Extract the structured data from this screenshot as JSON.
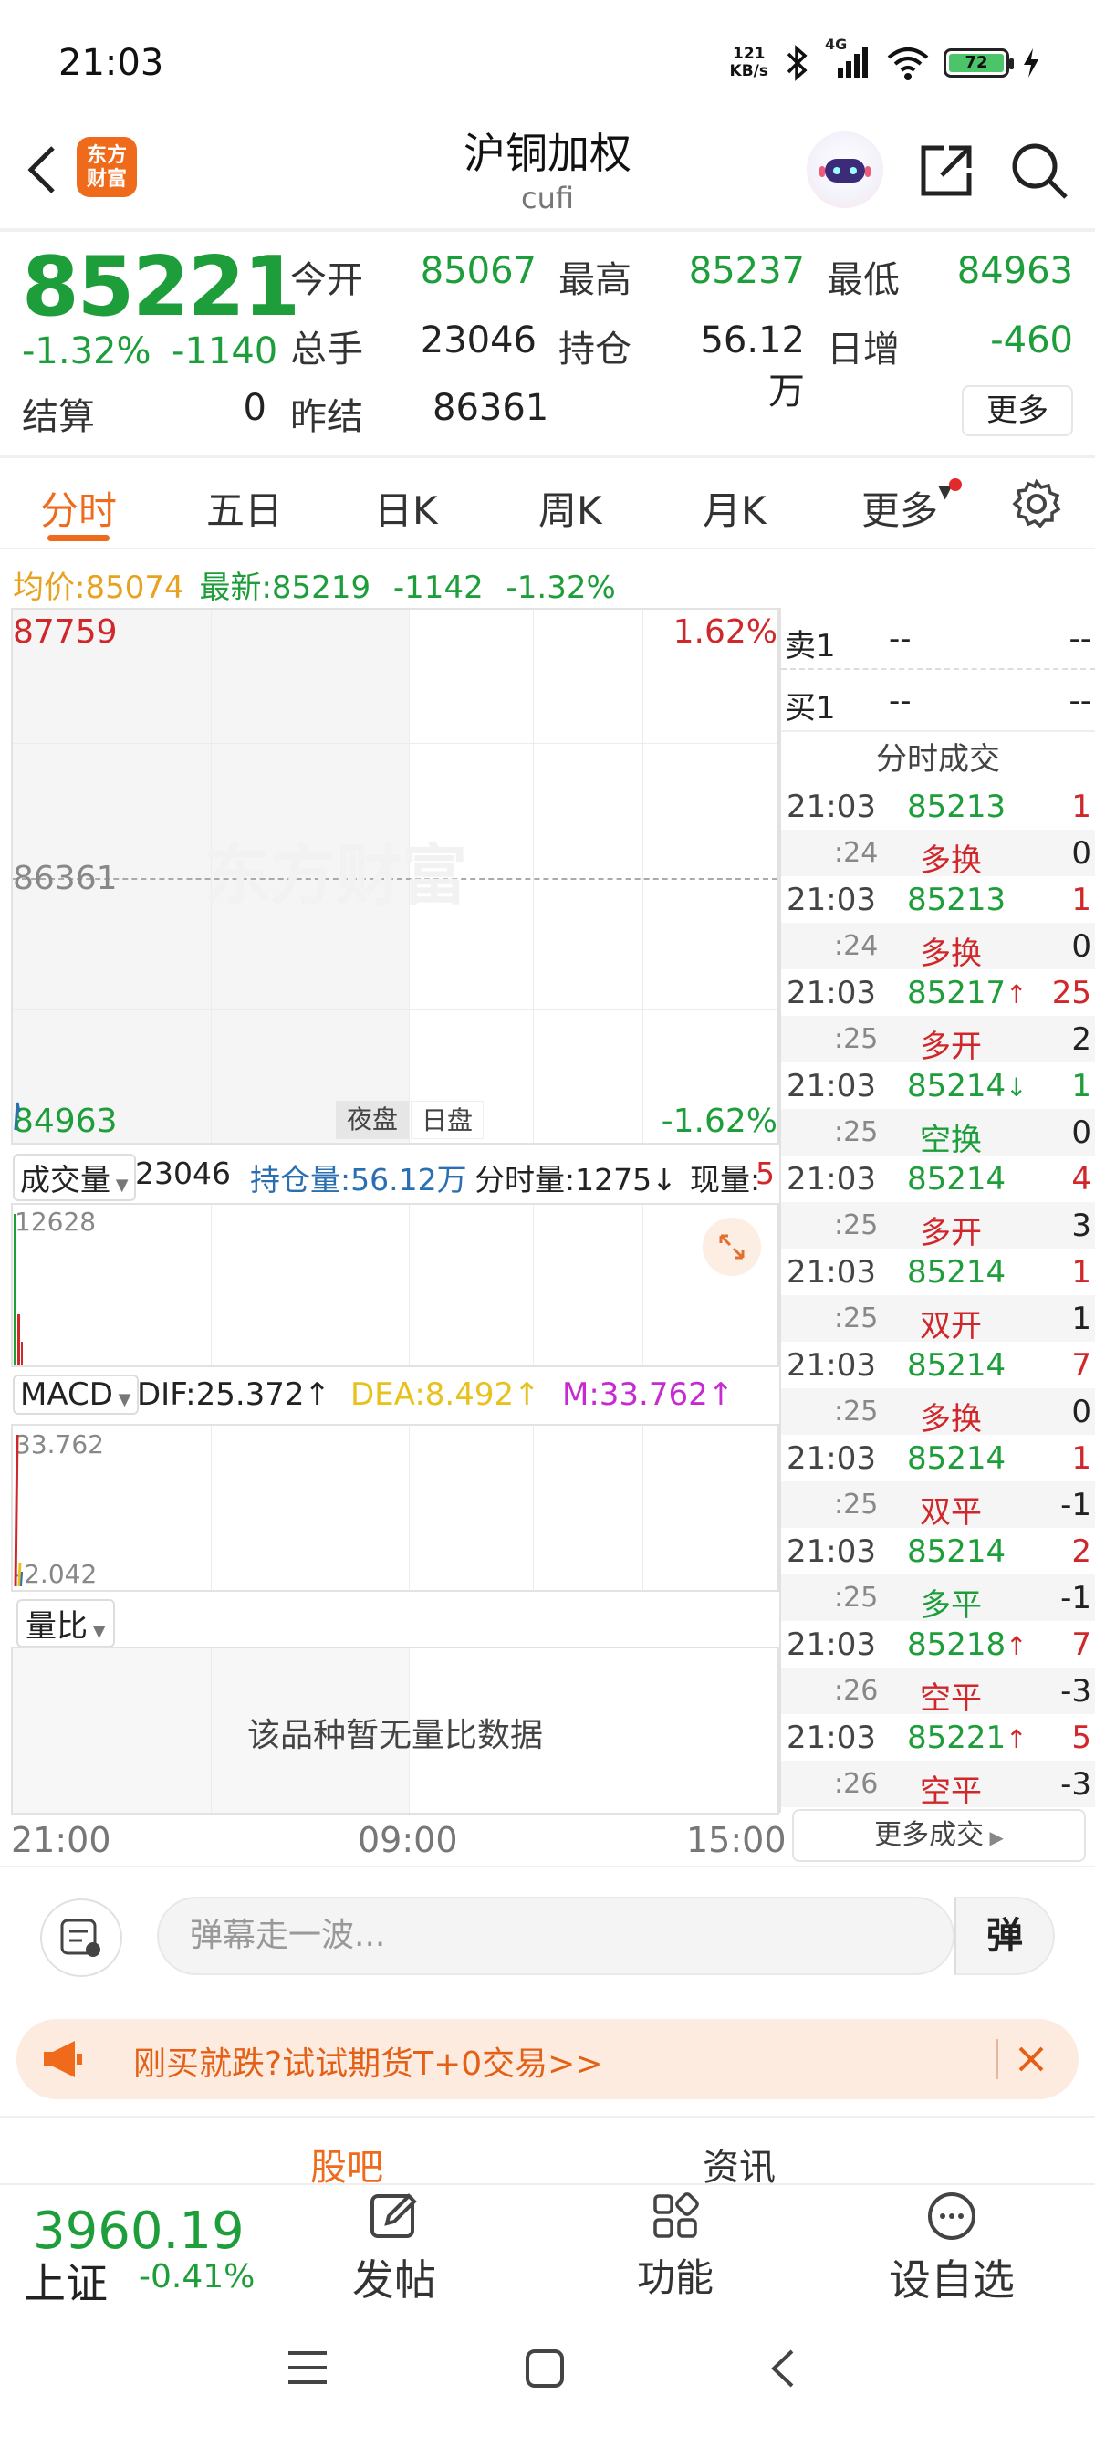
{
  "status_bar": {
    "time": "21:03",
    "net_speed_value": "121",
    "net_speed_unit": "KB/s",
    "network_type": "4G",
    "battery": "72"
  },
  "header": {
    "logo_text_line1": "东方",
    "logo_text_line2": "财富",
    "title": "沪铜加权",
    "subtitle": "cufi"
  },
  "quote": {
    "last_price": "85221",
    "change_pct": "-1.32%",
    "change": "-1140",
    "settlement_label": "结算",
    "settlement_value": "0",
    "prev_settle_label": "昨结",
    "prev_settle_value": "86361",
    "open_label": "今开",
    "open_value": "85067",
    "high_label": "最高",
    "high_value": "85237",
    "low_label": "最低",
    "low_value": "84963",
    "volume_label": "总手",
    "volume_value": "23046",
    "oi_label": "持仓",
    "oi_value": "56.12万",
    "daily_inc_label": "日增",
    "daily_inc_value": "-460",
    "more_label": "更多"
  },
  "tabs": [
    {
      "label": "分时"
    },
    {
      "label": "五日"
    },
    {
      "label": "日K"
    },
    {
      "label": "周K"
    },
    {
      "label": "月K"
    },
    {
      "label": "更多"
    }
  ],
  "info_line": {
    "avg_label": "均价:",
    "avg_value": "85074",
    "latest_label": "最新:",
    "latest_value": "85219",
    "latest_change": "-1142",
    "latest_pct": "-1.32%"
  },
  "price_chart": {
    "top_value": "87759",
    "top_pct": "1.62%",
    "mid_value": "86361",
    "bottom_value": "84963",
    "bottom_pct": "-1.62%",
    "watermark": "东方财富",
    "night_label": "夜盘",
    "day_label": "日盘"
  },
  "volume_bar": {
    "selector_label": "成交量",
    "volume_value": "23046",
    "oi_text": "持仓量:56.12万",
    "tick_vol_text": "分时量:1275↓",
    "current_vol_label": "现量:",
    "current_vol_value": "5",
    "max_label": "12628"
  },
  "macd": {
    "selector_label": "MACD",
    "dif_text": "DIF:25.372↑",
    "dea_text": "DEA:8.492↑",
    "m_text": "M:33.762↑",
    "top_label": "33.762",
    "bottom_label": "-2.042"
  },
  "volume_ratio": {
    "selector_label": "量比",
    "empty_text": "该品种暂无量比数据"
  },
  "time_axis": [
    "21:00",
    "09:00",
    "15:00"
  ],
  "order_book": {
    "ask_label": "卖1",
    "ask_price": "--",
    "ask_vol": "--",
    "bid_label": "买1",
    "bid_price": "--",
    "bid_vol": "--"
  },
  "trades": {
    "title": "分时成交",
    "more_label": "更多成交",
    "rows": [
      {
        "time": "21:03",
        "price": "85213",
        "arrow": "",
        "vol": "1",
        "sub": ":24",
        "type": "多换",
        "type_vol": "0"
      },
      {
        "time": "21:03",
        "price": "85213",
        "arrow": "",
        "vol": "1",
        "sub": ":24",
        "type": "多换",
        "type_vol": "0"
      },
      {
        "time": "21:03",
        "price": "85217",
        "arrow": "↑",
        "vol": "25",
        "sub": ":25",
        "type": "多开",
        "type_vol": "2"
      },
      {
        "time": "21:03",
        "price": "85214",
        "arrow": "↓",
        "vol": "1",
        "sub": ":25",
        "type": "空换",
        "type_vol": "0"
      },
      {
        "time": "21:03",
        "price": "85214",
        "arrow": "",
        "vol": "4",
        "sub": ":25",
        "type": "多开",
        "type_vol": "3"
      },
      {
        "time": "21:03",
        "price": "85214",
        "arrow": "",
        "vol": "1",
        "sub": ":25",
        "type": "双开",
        "type_vol": "1"
      },
      {
        "time": "21:03",
        "price": "85214",
        "arrow": "",
        "vol": "7",
        "sub": ":25",
        "type": "多换",
        "type_vol": "0"
      },
      {
        "time": "21:03",
        "price": "85214",
        "arrow": "",
        "vol": "1",
        "sub": ":25",
        "type": "双平",
        "type_vol": "-1"
      },
      {
        "time": "21:03",
        "price": "85214",
        "arrow": "",
        "vol": "2",
        "sub": ":25",
        "type": "多平",
        "type_vol": "-1"
      },
      {
        "time": "21:03",
        "price": "85218",
        "arrow": "↑",
        "vol": "7",
        "sub": ":26",
        "type": "空平",
        "type_vol": "-3"
      },
      {
        "time": "21:03",
        "price": "85221",
        "arrow": "↑",
        "vol": "5",
        "sub": ":26",
        "type": "空平",
        "type_vol": "-3"
      }
    ]
  },
  "comment_bar": {
    "placeholder": "弹幕走一波...",
    "danmaku_button": "弹"
  },
  "promo": {
    "text": "刚买就跌?试试期货T+0交易>>"
  },
  "sections": {
    "guba": "股吧",
    "news": "资讯"
  },
  "bottom_nav": {
    "index_value": "3960.19",
    "index_name": "上证",
    "index_pct": "-0.41%",
    "post_label": "发帖",
    "function_label": "功能",
    "watchlist_label": "设自选"
  },
  "colors": {
    "up": "#d0272b",
    "down": "#1e9e3a",
    "accent": "#ef6a1b",
    "avg": "#e7a21f",
    "oi_blue": "#2a6fb0",
    "macd_m": "#c62bd1"
  }
}
